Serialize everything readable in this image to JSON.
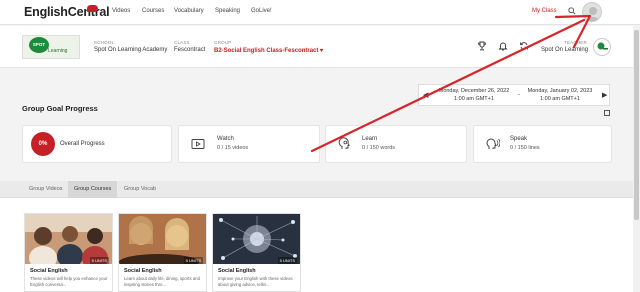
{
  "header": {
    "logo_text": "EnglishCentral",
    "nav": [
      "Videos",
      "Courses",
      "Vocabulary",
      "Speaking",
      "GoLive!"
    ],
    "my_class": "My Class"
  },
  "class_info": {
    "school_logo_text": "SPOT",
    "school_logo_sub": "Learning",
    "school_label": "SCHOOL",
    "school": "Spot On Learning Academy",
    "class_label": "CLASS",
    "class_name": "Fescontract",
    "group_label": "GROUP",
    "group": "B2-Social English Class-Fescontract ▾",
    "teacher_label": "TEACHER",
    "teacher": "Spot On Learning"
  },
  "date_range": {
    "start_date": "Monday, December 26, 2022",
    "start_time": "1:00 am GMT+1",
    "separator": "-",
    "end_date": "Monday, January 02, 2023",
    "end_time": "1:00 am GMT+1"
  },
  "section_title": "Group Goal Progress",
  "stats": {
    "overall": {
      "percent": "0%",
      "label": "Overall Progress"
    },
    "watch": {
      "label": "Watch",
      "value": "0 / 15 videos"
    },
    "learn": {
      "label": "Learn",
      "value": "0 / 150 words"
    },
    "speak": {
      "label": "Speak",
      "value": "0 / 150 lines"
    }
  },
  "tabs": [
    "Group Videos",
    "Group Courses",
    "Group Vocab"
  ],
  "active_tab": "Group Courses",
  "courses": [
    {
      "title": "Social English",
      "units": "5 UNITS",
      "desc": "These videos will help you enhance your English conversa..."
    },
    {
      "title": "Social English",
      "units": "5 UNITS",
      "desc": "Learn about daily life, dining, sports and inspiring stories thro..."
    },
    {
      "title": "Social English",
      "units": "5 UNITS",
      "desc": "Improve your English with these videos about giving advice, tellin..."
    }
  ],
  "colors": {
    "brand_red": "#c62027",
    "annotation_red": "#d6262b"
  }
}
